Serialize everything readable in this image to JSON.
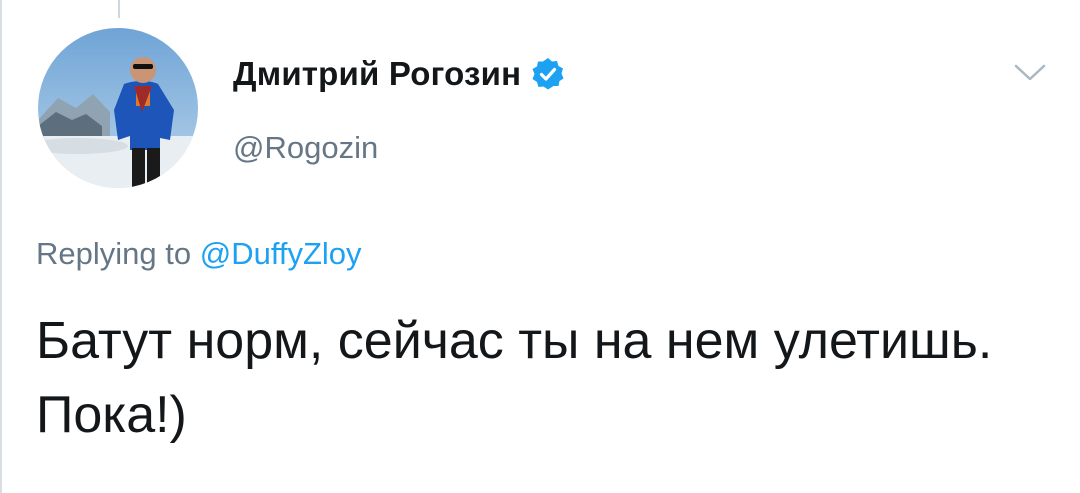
{
  "tweet": {
    "author": {
      "display_name": "Дмитрий Рогозин",
      "handle": "@Rogozin",
      "verified": true,
      "avatar_icon": "avatar-photo-mountain-icon"
    },
    "reply_context": {
      "prefix": "Replying to ",
      "mention": "@DuffyZloy"
    },
    "text": "Батут норм, сейчас ты на нем улетишь. Пока!)",
    "menu_icon": "chevron-down-icon"
  },
  "colors": {
    "text_primary": "#14171a",
    "text_secondary": "#657786",
    "accent": "#1da1f2",
    "verified_badge": "#1da1f2"
  }
}
